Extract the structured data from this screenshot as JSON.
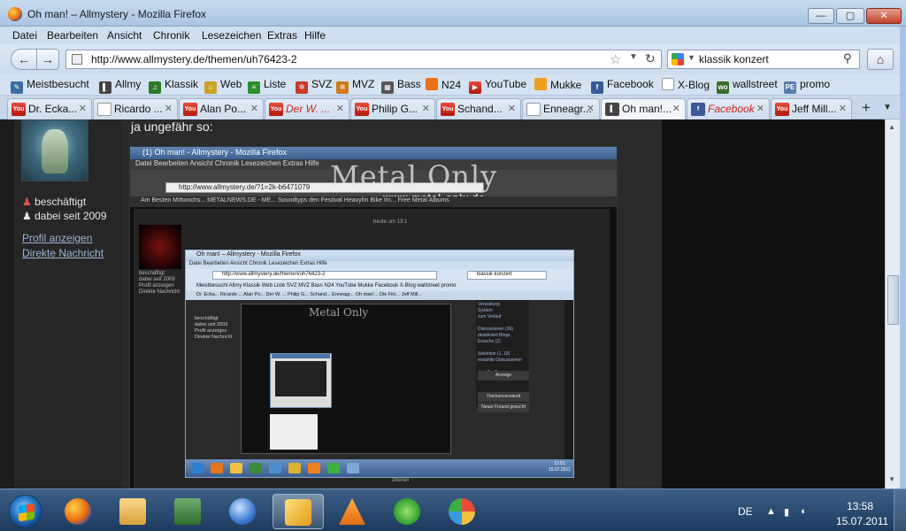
{
  "window": {
    "title": "Oh man! – Allmystery - Mozilla Firefox",
    "min": "—",
    "max": "▢",
    "close": "✕"
  },
  "menu": [
    "Datei",
    "Bearbeiten",
    "Ansicht",
    "Chronik",
    "Lesezeichen",
    "Extras",
    "Hilfe"
  ],
  "nav": {
    "url": "http://www.allmystery.de/themen/uh76423-2",
    "search": "klassik konzert"
  },
  "bookmarks": [
    {
      "label": "Meistbesucht",
      "icon": "pin-icon"
    },
    {
      "label": "Allmy",
      "icon": "allmy-icon"
    },
    {
      "label": "Klassik",
      "icon": "klassik-icon"
    },
    {
      "label": "Web",
      "icon": "web-icon"
    },
    {
      "label": "Liste",
      "icon": "liste-icon"
    },
    {
      "label": "SVZ",
      "icon": "svz-icon"
    },
    {
      "label": "MVZ",
      "icon": "mvz-icon"
    },
    {
      "label": "Bass",
      "icon": "bass-icon"
    },
    {
      "label": "N24",
      "icon": "n24-icon"
    },
    {
      "label": "YouTube",
      "icon": "youtube-icon"
    },
    {
      "label": "Mukke",
      "icon": "mukke-icon"
    },
    {
      "label": "Facebook",
      "icon": "facebook-icon"
    },
    {
      "label": "X-Blog",
      "icon": "page-icon"
    },
    {
      "label": "wallstreet",
      "icon": "wallstreet-icon"
    },
    {
      "label": "promo",
      "icon": "promo-icon"
    }
  ],
  "tabs": [
    {
      "label": "Dr. Ecka...",
      "icon": "youtube"
    },
    {
      "label": "Ricardo ...",
      "icon": "page"
    },
    {
      "label": "Alan Po...",
      "icon": "youtube"
    },
    {
      "label": "Der W. ...",
      "icon": "youtube"
    },
    {
      "label": "Philip G...",
      "icon": "youtube"
    },
    {
      "label": "Schand...",
      "icon": "youtube"
    },
    {
      "label": "Enneagr...",
      "icon": "page"
    },
    {
      "label": "Oh man!...",
      "icon": "allmy"
    },
    {
      "label": "Facebook",
      "icon": "facebook"
    },
    {
      "label": "Jeff Mill...",
      "icon": "youtube"
    }
  ],
  "tab_close": "✕",
  "tab_new": "+",
  "post": {
    "user_status": "beschäftigt",
    "member_since": "dabei seit 2009",
    "profile_link": "Profil anzeigen",
    "message_link": "Direkte Nachricht",
    "text": "ja ungefähr so:"
  },
  "embedded": {
    "title": "(1) Oh man! - Allmystery - Mozilla Firefox",
    "menu": "Datei  Bearbeiten  Ansicht  Chronik  Lesezeichen  Extras  Hilfe",
    "url": "http://www.allmystery.de/?1=2k-b6471079",
    "logo": "Metal Only",
    "logo_url": "www.metal-only.de",
    "bookmarks": "Am Besten Mittwochs...   METALNEWS.DE - ME...   Soundtyps den Festival   Heavyfm Bike Im...   Free Metal Albums",
    "side": "beschäftigt\ndabei seit 2009\nProfil anzeigen\nDirekte Nachricht",
    "right": "heute um 13:1",
    "bottom": "zitieren"
  },
  "inner": {
    "title": "Oh man! – Allmystery - Mozilla Firefox",
    "menu": "Datei  Bearbeiten  Ansicht  Chronik  Lesezeichen  Extras  Hilfe",
    "url": "http://www.allmystery.de/themen/uh76423-2",
    "search": "klassik konzert",
    "bookmarks": "Meistbesucht  Allmy  Klassik  Web  Liste  SVZ  MVZ  Bass  N24  YouTube  Mukke  Facebook  X-Blog  wallstreet  promo",
    "tabs": "Dr. Ecka...  Ricardo ...  Alan Po...  Der W. ...  Philip G...  Schand...  Enneagr...  Oh man!...  Die Filo...  Jeff Mill...",
    "side": "beschäftigt\ndabei seit 2009\nProfil anzeigen\nDirekte Nachricht",
    "right": "Verwaltung\nSystem\nzum Verlauf\n\nDiskussionen (36)\ndeaktiviert Blogs\nErsuche (2)\n\nSelektion (1, 18)\nerwählte Diskussionen\n\nzum Profil von",
    "box1": "Anzeige",
    "box2": "Themenverwandt",
    "box3": "Neuer Freund gesucht",
    "clock": "13:51\n15.07.2011"
  },
  "taskbar": {
    "lang": "DE",
    "time": "13:58",
    "date": "15.07.2011",
    "apps": [
      "firefox",
      "explorer",
      "network",
      "thunderbird",
      "winamp",
      "vlc",
      "icq",
      "paint"
    ]
  },
  "colors": {
    "accent": "#3c5f87",
    "link": "#9db5d6",
    "youtube_red": "#b1160c",
    "facebook_blue": "#3b5998"
  }
}
